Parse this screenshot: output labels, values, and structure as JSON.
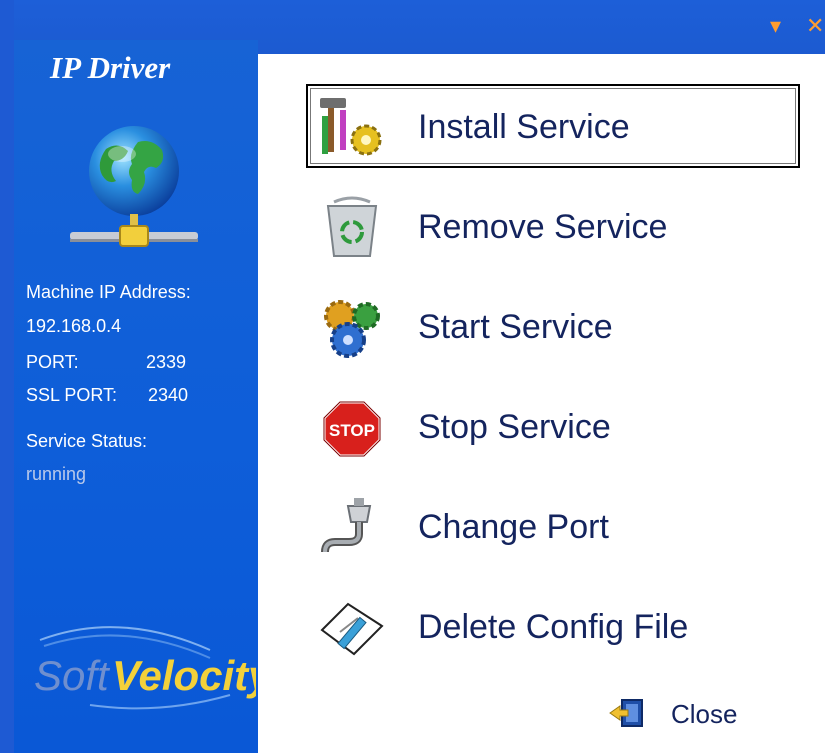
{
  "window": {
    "dropdown_glyph": "▾",
    "close_glyph": "✕"
  },
  "sidebar": {
    "app_title": "IP Driver",
    "machine_ip_label": "Machine IP Address:",
    "machine_ip_value": "192.168.0.4",
    "port_label": "PORT:",
    "port_value": "2339",
    "ssl_port_label": "SSL PORT:",
    "ssl_port_value": "2340",
    "service_status_label": "Service Status:",
    "service_status_value": "running",
    "logo_text": "SoftVelocity"
  },
  "menu": {
    "items": [
      {
        "label": "Install Service",
        "icon": "tools-gear-icon",
        "focused": true
      },
      {
        "label": "Remove Service",
        "icon": "recycle-bin-icon"
      },
      {
        "label": "Start Service",
        "icon": "gears-icon"
      },
      {
        "label": "Stop Service",
        "icon": "stop-sign-icon"
      },
      {
        "label": "Change Port",
        "icon": "port-cable-icon"
      },
      {
        "label": "Delete Config File",
        "icon": "edit-file-icon"
      }
    ],
    "close_label": "Close"
  },
  "colors": {
    "sidebar_blue": "#0e5ed9",
    "label_text": "#14245e",
    "status_text": "#b9c9ea"
  }
}
